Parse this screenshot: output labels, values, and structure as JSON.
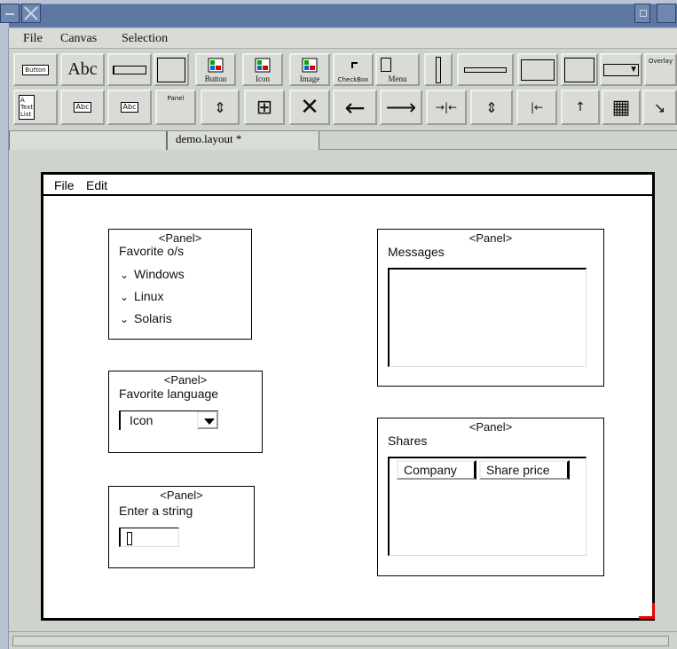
{
  "menubar": {
    "items": [
      "File",
      "Canvas",
      "Selection"
    ]
  },
  "toolbar": {
    "row1": {
      "button_text": "Button",
      "abc": "Abc",
      "button_label": "Button",
      "icon_label": "Icon",
      "image_label": "Image",
      "checkbox_label": "CheckBox",
      "menu_label": "Menu",
      "overlay_label": "Overlay"
    },
    "row2": {
      "text_list": "A Text List",
      "abc1": "Abc",
      "abc2": "Abc",
      "panel": "Panel"
    }
  },
  "tabs": {
    "active": "demo.layout *"
  },
  "design": {
    "menu": [
      "File",
      "Edit"
    ],
    "panels": {
      "os": {
        "title": "<Panel>",
        "label": "Favorite o/s",
        "options": [
          "Windows",
          "Linux",
          "Solaris"
        ]
      },
      "language": {
        "title": "<Panel>",
        "label": "Favorite language",
        "combo_value": "Icon"
      },
      "string": {
        "title": "<Panel>",
        "label": "Enter a string"
      },
      "messages": {
        "title": "<Panel>",
        "label": "Messages"
      },
      "shares": {
        "title": "<Panel>",
        "label": "Shares",
        "columns": [
          "Company",
          "Share price"
        ]
      }
    }
  },
  "colors": {
    "titlebar": "#5c77a2",
    "selection_corner": "#e00000"
  }
}
